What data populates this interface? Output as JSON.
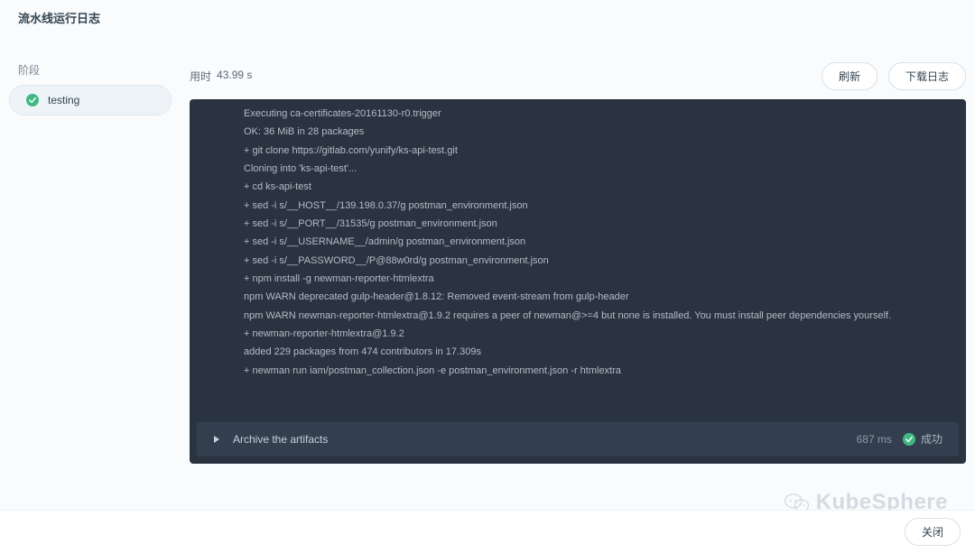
{
  "title": "流水线运行日志",
  "sidebar": {
    "label": "阶段",
    "stage": {
      "name": "testing",
      "status": "success"
    }
  },
  "main": {
    "duration_label": "用时",
    "duration_value": "43.99 s",
    "refresh_label": "刷新",
    "download_label": "下载日志"
  },
  "log_lines": [
    "Executing ca-certificates-20161130-r0.trigger",
    "OK: 36 MiB in 28 packages",
    "+ git clone https://gitlab.com/yunify/ks-api-test.git",
    "Cloning into 'ks-api-test'...",
    "+ cd ks-api-test",
    "+ sed -i s/__HOST__/139.198.0.37/g postman_environment.json",
    "+ sed -i s/__PORT__/31535/g postman_environment.json",
    "+ sed -i s/__USERNAME__/admin/g postman_environment.json",
    "+ sed -i s/__PASSWORD__/P@88w0rd/g postman_environment.json",
    "+ npm install -g newman-reporter-htmlextra",
    "npm WARN deprecated gulp-header@1.8.12: Removed event-stream from gulp-header",
    "npm WARN newman-reporter-htmlextra@1.9.2 requires a peer of newman@>=4 but none is installed. You must install peer dependencies yourself.",
    "",
    "+ newman-reporter-htmlextra@1.9.2",
    "added 229 packages from 474 contributors in 17.309s",
    "+ newman run iam/postman_collection.json -e postman_environment.json -r htmlextra"
  ],
  "artifacts": {
    "label": "Archive the artifacts",
    "time": "687 ms",
    "status_text": "成功"
  },
  "brand": "KubeSphere",
  "footer": {
    "close_label": "关闭"
  }
}
